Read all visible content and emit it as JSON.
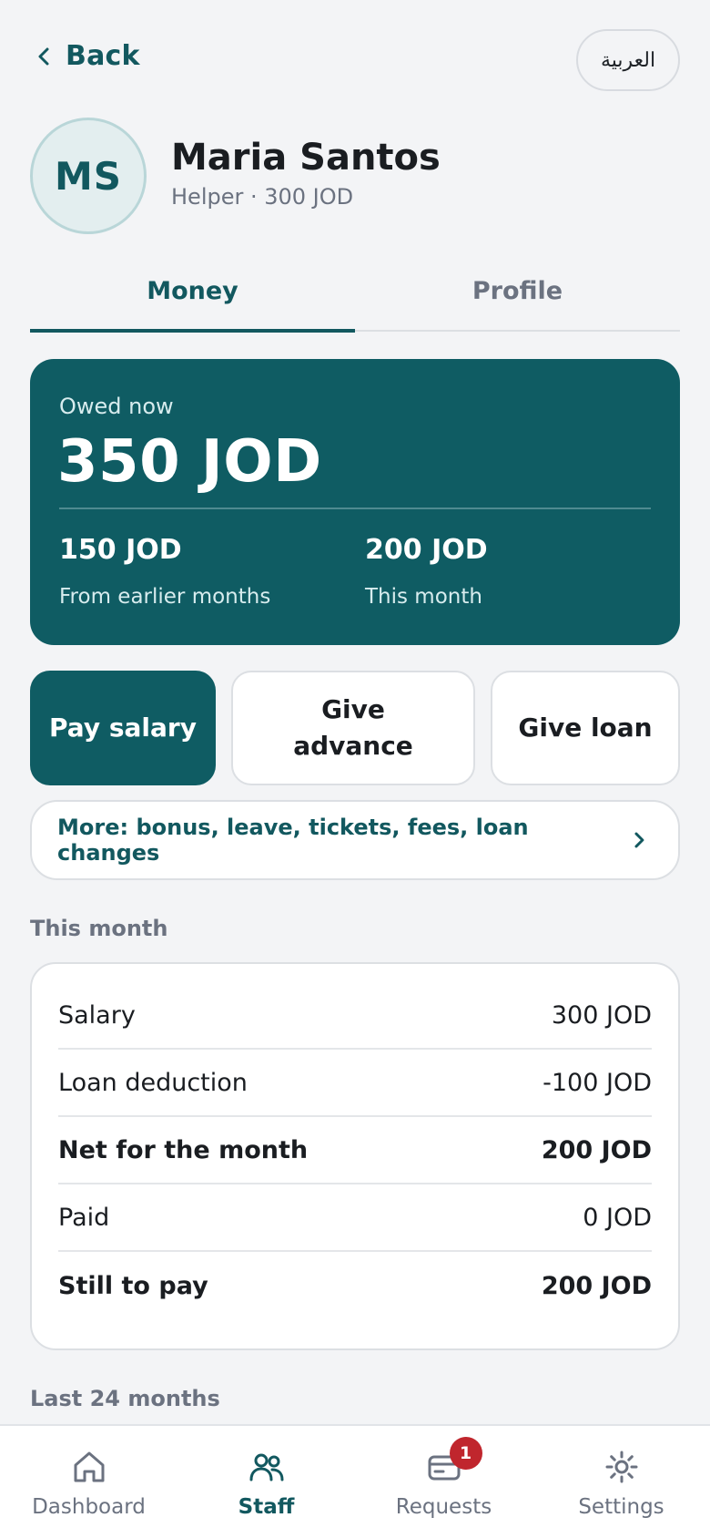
{
  "header": {
    "back_label": "Back",
    "language_label": "العربية"
  },
  "person": {
    "initials": "MS",
    "name": "Maria Santos",
    "subtitle": "Helper · 300 JOD"
  },
  "tabs": [
    {
      "label": "Money",
      "active": true
    },
    {
      "label": "Profile",
      "active": false
    }
  ],
  "owed_card": {
    "caption": "Owed now",
    "amount": "350 JOD",
    "earlier_amount": "150 JOD",
    "earlier_caption": "From earlier months",
    "this_month_amount": "200 JOD",
    "this_month_caption": "This month"
  },
  "actions": {
    "pay_salary": "Pay salary",
    "give_advance": "Give advance",
    "give_loan": "Give loan"
  },
  "more_link": {
    "label": "More: bonus, leave, tickets, fees, loan changes",
    "icon": "chevron-right-icon"
  },
  "this_month": {
    "title": "This month",
    "rows": [
      {
        "label": "Salary",
        "value": "300 JOD",
        "bold": false
      },
      {
        "label": "Loan deduction",
        "value": "-100 JOD",
        "bold": false
      },
      {
        "label": "Net for the month",
        "value": "200 JOD",
        "bold": true
      },
      {
        "label": "Paid",
        "value": "0 JOD",
        "bold": false
      },
      {
        "label": "Still to pay",
        "value": "200 JOD",
        "bold": true
      }
    ]
  },
  "last_months": {
    "title": "Last 24 months"
  },
  "nav": {
    "items": [
      {
        "label": "Dashboard",
        "icon": "home-icon",
        "active": false
      },
      {
        "label": "Staff",
        "icon": "people-icon",
        "active": true
      },
      {
        "label": "Requests",
        "icon": "card-icon",
        "active": false,
        "badge": "1"
      },
      {
        "label": "Settings",
        "icon": "gear-icon",
        "active": false
      }
    ]
  },
  "colors": {
    "accent": "#0f5c63",
    "badge": "#c0262d",
    "background": "#f3f4f6"
  }
}
